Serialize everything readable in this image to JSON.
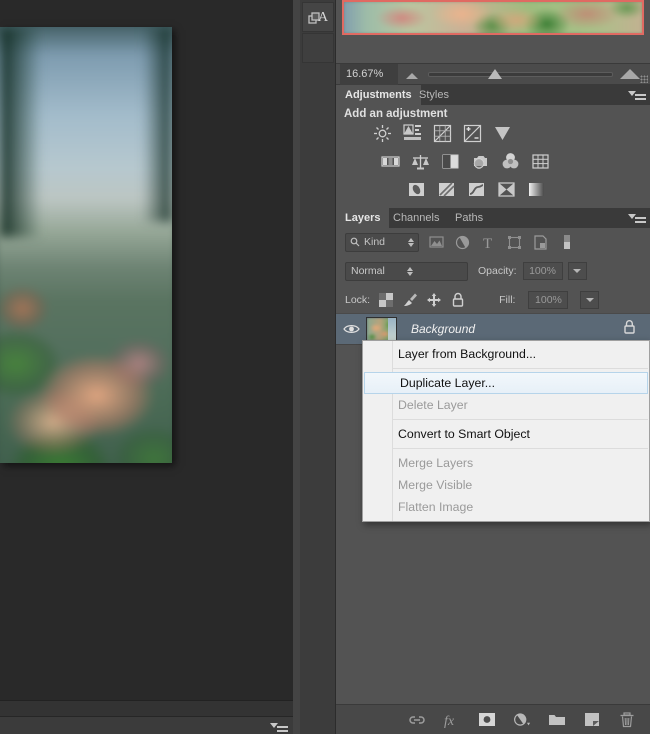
{
  "document": {
    "zoom_level": "16.67%",
    "canvas_alt": "blurred photograph of pink and green flowering plant"
  },
  "dock": {
    "character_panel_icon": "character-panel-icon"
  },
  "navigator": {
    "selection_color": "#e06a62"
  },
  "adjustments": {
    "tabs": [
      {
        "label": "Adjustments",
        "active": true
      },
      {
        "label": "Styles",
        "active": false
      }
    ],
    "heading": "Add an adjustment",
    "icons_row1": [
      "brightness-contrast-icon",
      "levels-icon",
      "curves-icon",
      "exposure-icon",
      "vibrance-icon"
    ],
    "icons_row2": [
      "hue-saturation-icon",
      "color-balance-icon",
      "black-white-icon",
      "photo-filter-icon",
      "channel-mixer-icon",
      "color-lookup-icon"
    ],
    "icons_row3": [
      "invert-icon",
      "posterize-icon",
      "threshold-icon",
      "selective-color-icon",
      "gradient-map-icon"
    ],
    "menu_icon": "panel-menu-icon"
  },
  "floating_panel": {
    "collapse_label": "»",
    "close_label": "✕",
    "icon": "levels-icon"
  },
  "layers": {
    "tabs": [
      {
        "label": "Layers",
        "active": true
      },
      {
        "label": "Channels",
        "active": false
      },
      {
        "label": "Paths",
        "active": false
      }
    ],
    "menu_icon": "panel-menu-icon",
    "filter": {
      "kind_label": "Kind",
      "search_icon": "search-icon",
      "type_icons": [
        "pixel-filter-icon",
        "adjustment-filter-icon",
        "type-filter-icon",
        "shape-filter-icon",
        "smart-object-filter-icon",
        "filter-toggle-icon"
      ]
    },
    "blend": {
      "mode": "Normal",
      "opacity_label": "Opacity:",
      "opacity_value": "100%"
    },
    "lock": {
      "label": "Lock:",
      "icons": [
        "lock-transparency-icon",
        "lock-image-icon",
        "lock-position-icon",
        "lock-all-icon"
      ],
      "fill_label": "Fill:",
      "fill_value": "100%"
    },
    "rows": [
      {
        "name": "Background",
        "visible": true,
        "locked": true,
        "selected": true,
        "eye_icon": "eye-icon",
        "lock_icon": "lock-icon"
      }
    ],
    "bottom_icons": [
      "link-layers-icon",
      "layer-style-fx-icon",
      "layer-mask-icon",
      "new-fill-adjustment-icon",
      "new-group-icon",
      "new-layer-icon",
      "delete-layer-icon"
    ]
  },
  "context_menu": {
    "items": [
      {
        "label": "Layer from Background...",
        "disabled": false,
        "selected": false,
        "separator_after": true
      },
      {
        "label": "Duplicate Layer...",
        "disabled": false,
        "selected": true,
        "separator_after": false
      },
      {
        "label": "Delete Layer",
        "disabled": true,
        "selected": false,
        "separator_after": true
      },
      {
        "label": "Convert to Smart Object",
        "disabled": false,
        "selected": false,
        "separator_after": true
      },
      {
        "label": "Merge Layers",
        "disabled": true,
        "selected": false,
        "separator_after": false
      },
      {
        "label": "Merge Visible",
        "disabled": true,
        "selected": false,
        "separator_after": false
      },
      {
        "label": "Flatten Image",
        "disabled": true,
        "selected": false,
        "separator_after": false
      }
    ]
  },
  "colors": {
    "panel_bg": "#535353",
    "tabbar_bg": "#3a3a3a",
    "selected_layer": "#5b6976",
    "menu_highlight": "#e7f0f8"
  }
}
